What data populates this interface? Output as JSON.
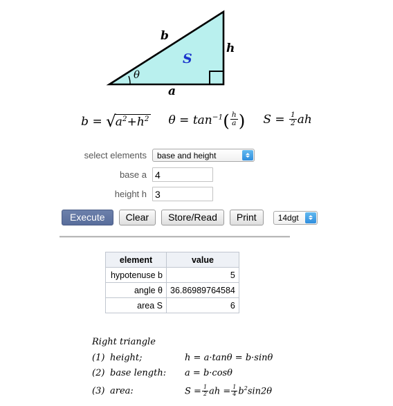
{
  "figure": {
    "name": "right-triangle-diagram",
    "fill_color": "#b9f0ee",
    "stroke_color": "#000000",
    "area_label_color": "#1a35cc",
    "labels": {
      "hypotenuse": "b",
      "height": "h",
      "base": "a",
      "angle": "θ",
      "area": "S"
    }
  },
  "formulas_top": {
    "hypotenuse": {
      "lhs": "b",
      "eq": "=",
      "radical": "√",
      "radicand_a": "a",
      "exp2a": "2",
      "plus": "+",
      "radicand_h": "h",
      "exp2h": "2"
    },
    "angle": {
      "lhs": "θ",
      "eq": "=",
      "fn": "tan",
      "exp": "−1",
      "num": "h",
      "den": "a"
    },
    "area": {
      "lhs": "S",
      "eq": "=",
      "num": "1",
      "den": "2",
      "rest": "ah"
    }
  },
  "form": {
    "select_elements": {
      "label": "select elements",
      "value": "base and height"
    },
    "base": {
      "label": "base a",
      "value": "4"
    },
    "height": {
      "label": "height h",
      "value": "3"
    }
  },
  "buttons": {
    "execute": "Execute",
    "clear": "Clear",
    "store_read": "Store/Read",
    "print": "Print",
    "digits": "14dgt"
  },
  "results": {
    "headers": [
      "element",
      "value"
    ],
    "rows": [
      {
        "element": "hypotenuse b",
        "value": "5"
      },
      {
        "element": "angle θ",
        "value": "36.86989764584"
      },
      {
        "element": "area S",
        "value": "6"
      }
    ]
  },
  "notes": {
    "title": "Right triangle",
    "items": [
      {
        "idx": "(1)",
        "key": "height;",
        "math_plain": "h = a·tanθ = b·sinθ"
      },
      {
        "idx": "(2)",
        "key": "base length:",
        "math_plain": "a = b·cosθ"
      },
      {
        "idx": "(3)",
        "key": "area:",
        "math_plain": "S = 1/2 ah = 1/4 b²sin2θ"
      }
    ],
    "item3": {
      "lhs": "S",
      "eq1": "=",
      "num1": "1",
      "den1": "2",
      "mid": "ah",
      "eq2": "=",
      "num2": "1",
      "den2": "4",
      "tail_b": "b",
      "tail_exp": "2",
      "tail_rest": "sin2θ"
    },
    "item1_math": {
      "lhs": "h",
      "eq1": "=",
      "t1": "a·tanθ",
      "eq2": "=",
      "t2": "b·sinθ"
    },
    "item2_math": {
      "lhs": "a",
      "eq1": "=",
      "t1": "b·cosθ"
    }
  }
}
